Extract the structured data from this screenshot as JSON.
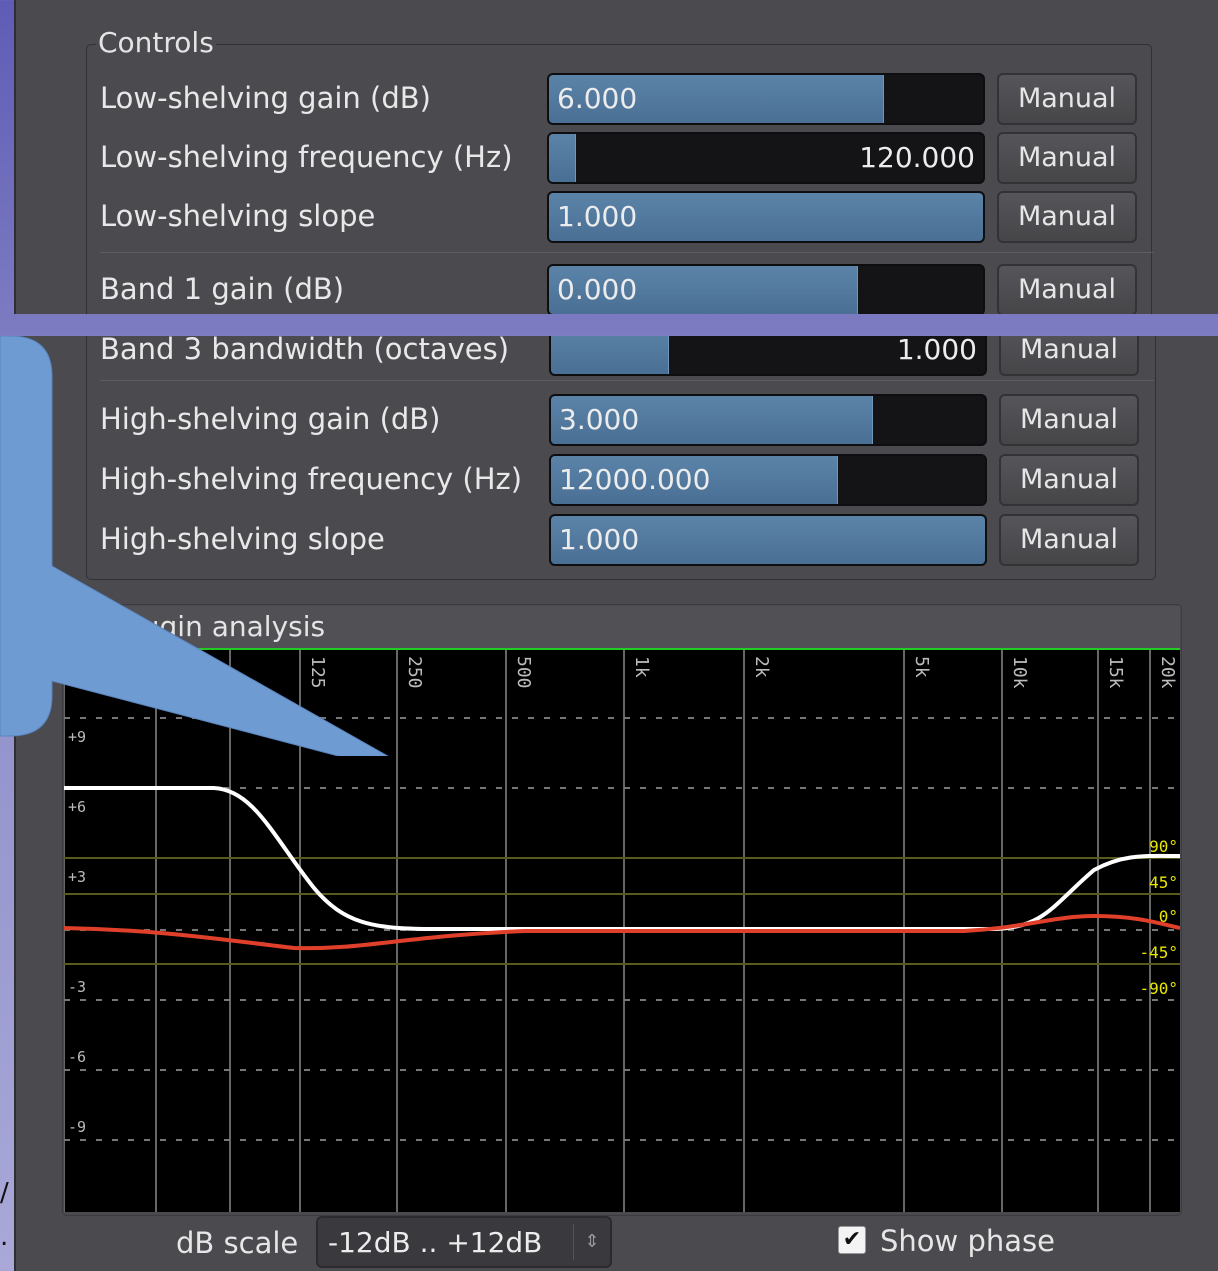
{
  "controls": {
    "group_title": "Controls",
    "rows_top": [
      {
        "label": "Low-shelving gain (dB)",
        "value": "6.000",
        "fill": 0.77,
        "align": "left",
        "button": "Manual"
      },
      {
        "label": "Low-shelving frequency (Hz)",
        "value": "120.000",
        "fill": 0.06,
        "align": "right",
        "button": "Manual"
      },
      {
        "label": "Low-shelving slope",
        "value": "1.000",
        "fill": 1.0,
        "align": "left",
        "button": "Manual"
      },
      {
        "label": "Band 1 gain (dB)",
        "value": "0.000",
        "fill": 0.71,
        "align": "left",
        "button": "Manual"
      }
    ],
    "rows_bottom": [
      {
        "label": "Band 3 bandwidth (octaves)",
        "value": "1.000",
        "fill": 0.27,
        "align": "right",
        "button": "Manual"
      },
      {
        "label": "High-shelving gain (dB)",
        "value": "3.000",
        "fill": 0.74,
        "align": "left",
        "button": "Manual"
      },
      {
        "label": "High-shelving frequency (Hz)",
        "value": "12000.000",
        "fill": 0.66,
        "align": "left",
        "button": "Manual"
      },
      {
        "label": "High-shelving slope",
        "value": "1.000",
        "fill": 1.0,
        "align": "left",
        "button": "Manual"
      }
    ]
  },
  "analysis": {
    "group_title": "lugin analysis",
    "freq_labels": [
      "125",
      "250",
      "500",
      "1k",
      "2k",
      "5k",
      "10k",
      "15k",
      "20k"
    ],
    "db_labels": [
      "+9",
      "+6",
      "+3",
      "-3",
      "-6",
      "-9"
    ],
    "phase_labels": [
      "90°",
      "45°",
      "0°",
      "-45°",
      "-90°"
    ],
    "colors": {
      "magnitude": "#ffffff",
      "phase": "#e0402a",
      "phase_label": "#e8e800",
      "top_line": "#22cc22"
    }
  },
  "bottom": {
    "db_scale_label": "dB scale",
    "db_scale_value": "-12dB .. +12dB",
    "show_phase_label": "Show phase",
    "show_phase_checked": "✔"
  },
  "edge_text": [
    "/",
    "."
  ]
}
